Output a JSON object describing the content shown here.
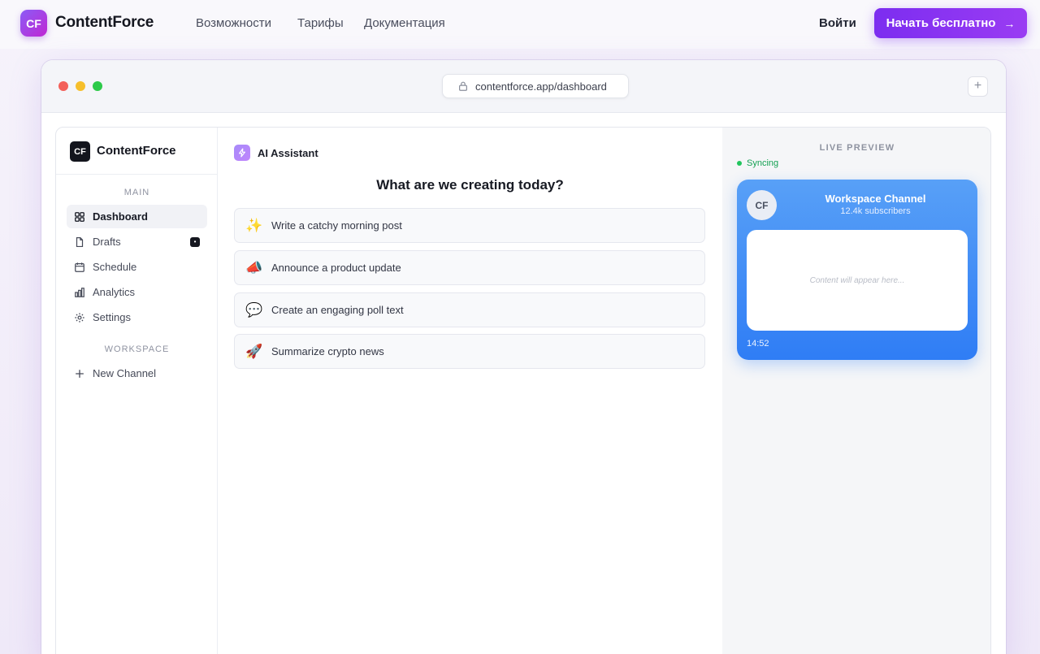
{
  "topnav": {
    "logo_badge": "CF",
    "logo_text": "ContentForce",
    "links": [
      "Возможности",
      "Тарифы",
      "Документация"
    ],
    "login": "Войти",
    "cta": "Начать бесплатно",
    "cta_icon": "arrow-right-icon"
  },
  "browser": {
    "url": "contentforce.app/dashboard",
    "new_tab_symbol": "+"
  },
  "sidebar": {
    "logo_badge": "CF",
    "title": "ContentForce",
    "section_main": "MAIN",
    "items": [
      {
        "label": "Dashboard",
        "icon": "grid-icon"
      },
      {
        "label": "Drafts",
        "icon": "file-icon",
        "badge": "•"
      },
      {
        "label": "Schedule",
        "icon": "calendar-icon"
      },
      {
        "label": "Analytics",
        "icon": "bar-chart-icon"
      },
      {
        "label": "Settings",
        "icon": "gear-icon"
      }
    ],
    "section_workspace": "WORKSPACE",
    "new_channel": "New Channel"
  },
  "main": {
    "assistant_title": "AI Assistant",
    "headline": "What are we creating today?",
    "prompts": [
      {
        "emoji": "✨",
        "label": "Write a catchy morning post"
      },
      {
        "emoji": "📣",
        "label": "Announce a product update"
      },
      {
        "emoji": "💬",
        "label": "Create an engaging poll text"
      },
      {
        "emoji": "🚀",
        "label": "Summarize crypto news"
      }
    ]
  },
  "preview": {
    "label": "LIVE PREVIEW",
    "status": "Syncing",
    "channel": {
      "avatar": "CF",
      "name": "Workspace Channel",
      "subscribers": "12.4k subscribers",
      "placeholder": "Content will appear here...",
      "time": "14:52"
    }
  },
  "colors": {
    "accent": "#7c2df0",
    "preview_card": "#2f7df5",
    "sync_green": "#22c55e"
  }
}
